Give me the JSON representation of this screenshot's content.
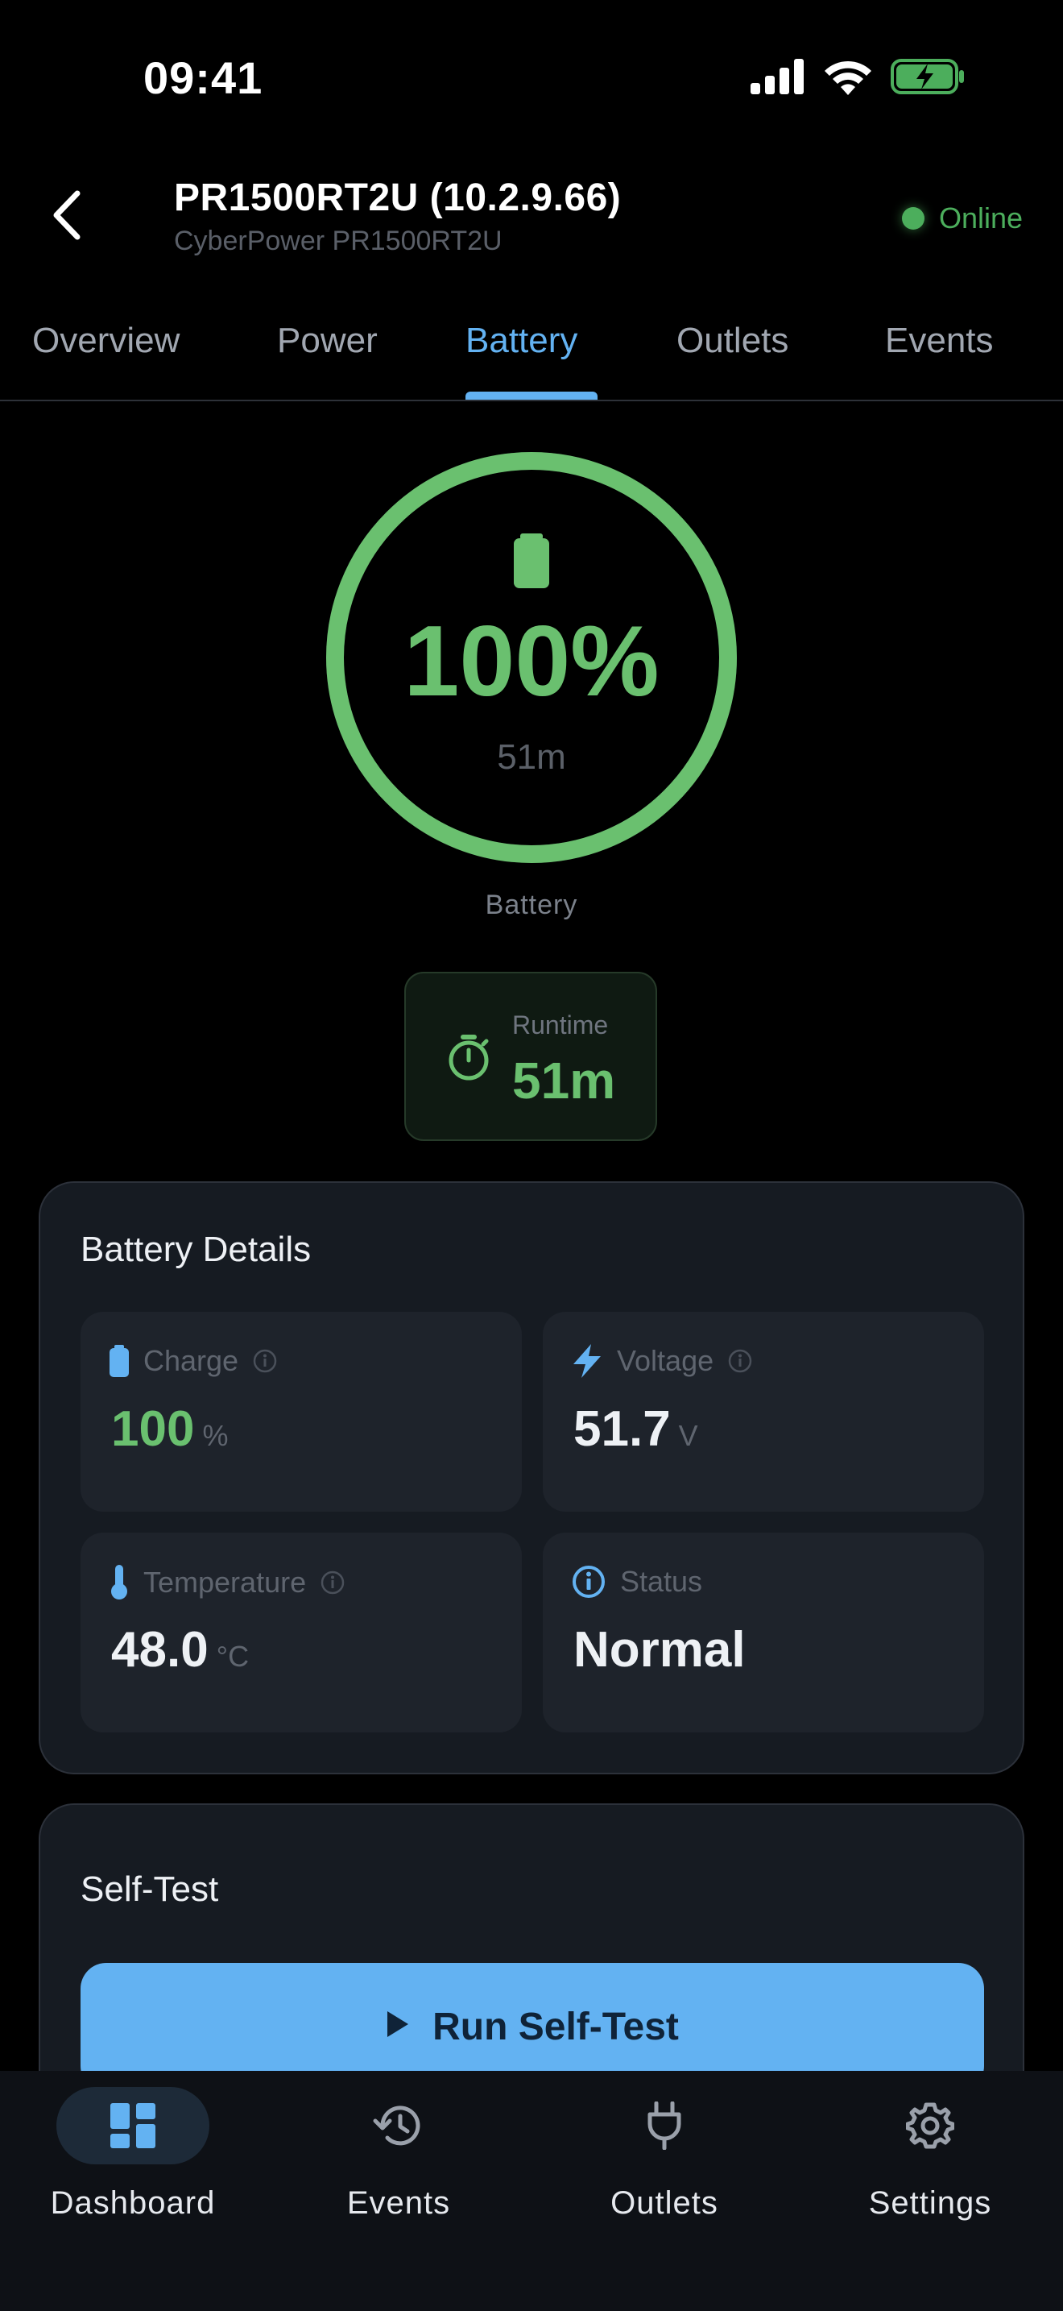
{
  "status_bar": {
    "time": "09:41",
    "icons": [
      "signal-icon",
      "wifi-icon",
      "battery-charging-icon"
    ]
  },
  "header": {
    "title": "PR1500RT2U (10.2.9.66)",
    "subtitle": "CyberPower PR1500RT2U",
    "status": "Online",
    "status_color": "#4cae5c"
  },
  "tabs": [
    {
      "label": "Overview",
      "active": false
    },
    {
      "label": "Power",
      "active": false
    },
    {
      "label": "Battery",
      "active": true
    },
    {
      "label": "Outlets",
      "active": false
    },
    {
      "label": "Events",
      "active": false
    }
  ],
  "gauge": {
    "percent_text": "100%",
    "level": 1.0,
    "runtime_text": "51m",
    "label": "Battery",
    "color": "#6ac06f"
  },
  "runtime": {
    "label": "Runtime",
    "value": "51m"
  },
  "battery_details": {
    "title": "Battery Details",
    "tiles": [
      {
        "label": "Charge",
        "value": "100",
        "unit": "%",
        "icon": "battery-icon"
      },
      {
        "label": "Voltage",
        "value": "51.7",
        "unit": "V",
        "icon": "bolt-icon"
      },
      {
        "label": "Temperature",
        "value": "48.0",
        "unit": "°C",
        "icon": "thermometer-icon"
      },
      {
        "label": "Status",
        "value": "Normal",
        "unit": "",
        "icon": "info-icon"
      }
    ]
  },
  "self_test": {
    "title": "Self-Test",
    "button_label": "Run Self-Test"
  },
  "bottom_nav": [
    {
      "label": "Dashboard",
      "icon": "dashboard-icon",
      "active": true
    },
    {
      "label": "Events",
      "icon": "history-icon",
      "active": false
    },
    {
      "label": "Outlets",
      "icon": "plug-icon",
      "active": false
    },
    {
      "label": "Settings",
      "icon": "gear-icon",
      "active": false
    }
  ],
  "colors": {
    "accent": "#63b2f2",
    "success": "#6ac06f",
    "card": "#161b22",
    "tile": "#1e232b"
  }
}
